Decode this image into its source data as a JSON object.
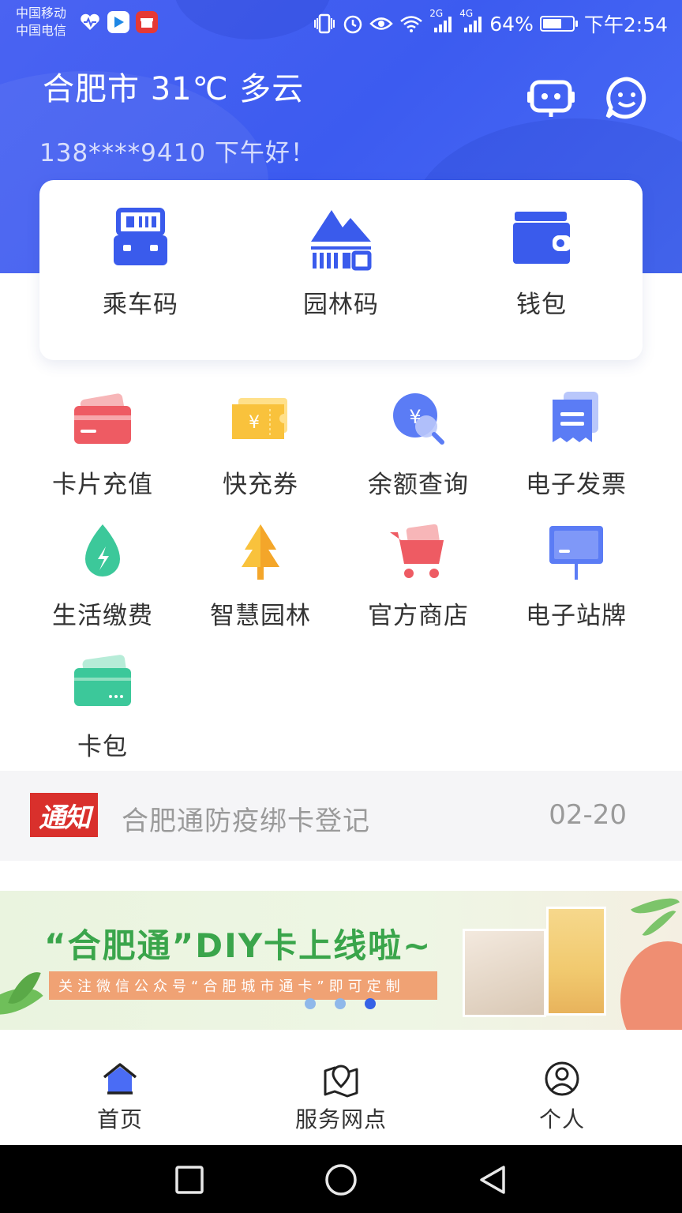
{
  "status_bar": {
    "carrier_1": "中国移动",
    "carrier_2": "中国电信",
    "network_1": "2G",
    "network_2": "4G",
    "battery": "64%",
    "battery_level": 0.64,
    "time": "下午2:54",
    "app_icons": [
      "heart-app-icon",
      "video-app-icon",
      "gift-app-icon"
    ]
  },
  "header": {
    "city_weather": "合肥市 31℃ 多云",
    "greeting": "138****9410  下午好！",
    "icons": [
      "customer-service-icon",
      "smile-chat-icon"
    ]
  },
  "quick_actions": [
    {
      "label": "乘车码",
      "icon": "bus-code-icon"
    },
    {
      "label": "园林码",
      "icon": "garden-code-icon"
    },
    {
      "label": "钱包",
      "icon": "wallet-icon"
    }
  ],
  "services": [
    {
      "label": "卡片充值",
      "icon": "card-recharge-icon"
    },
    {
      "label": "快充券",
      "icon": "coupon-icon"
    },
    {
      "label": "余额查询",
      "icon": "balance-query-icon"
    },
    {
      "label": "电子发票",
      "icon": "invoice-icon"
    },
    {
      "label": "生活缴费",
      "icon": "utility-payment-icon"
    },
    {
      "label": "智慧园林",
      "icon": "smart-garden-icon"
    },
    {
      "label": "官方商店",
      "icon": "shop-cart-icon"
    },
    {
      "label": "电子站牌",
      "icon": "e-station-sign-icon"
    },
    {
      "label": "卡包",
      "icon": "card-pack-icon"
    }
  ],
  "notice": {
    "badge": "通知",
    "text": "合肥通防疫绑卡登记",
    "date": "02-20"
  },
  "banner": {
    "title": "“合肥通”DIY卡上线啦~",
    "subtitle": "关注微信公众号“合肥城市通卡”即可定制",
    "dot_count": 3,
    "active_dot": 3
  },
  "tab_bar": [
    {
      "label": "首页",
      "icon": "home-icon",
      "active": true
    },
    {
      "label": "服务网点",
      "icon": "map-location-icon",
      "active": false
    },
    {
      "label": "个人",
      "icon": "person-icon",
      "active": false
    }
  ],
  "colors": {
    "header_blue": "#4a63f2",
    "accent_blue": "#3562e6",
    "notice_red": "#d9302c",
    "banner_green": "#3aa54b"
  }
}
